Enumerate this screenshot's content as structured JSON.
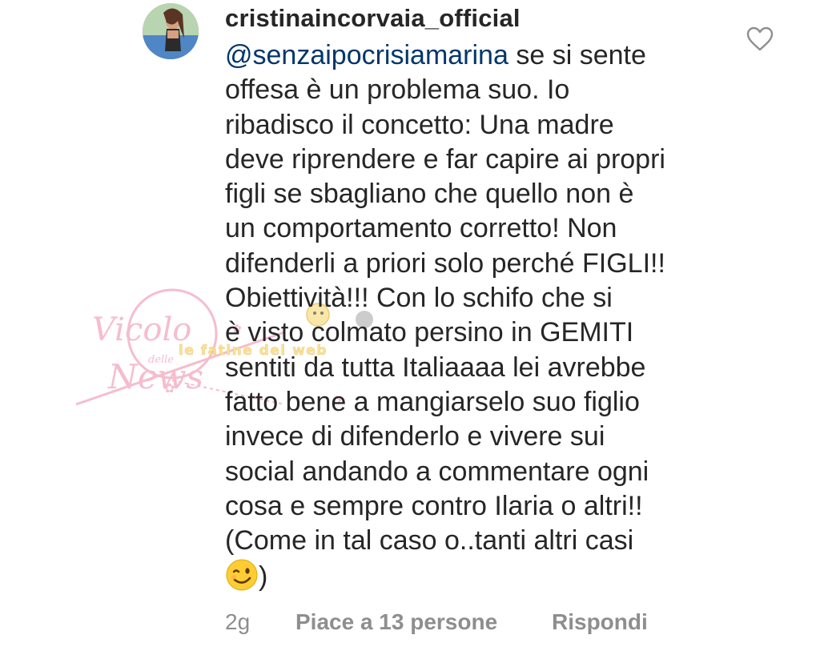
{
  "comment": {
    "username": "cristinaincorvaia_official",
    "mention": "@senzaipocrisiamarina",
    "lines": [
      " se si sente",
      "offesa è un problema suo. Io",
      "ribadisco il concetto: Una madre",
      "deve riprendere e far capire ai propri",
      "figli se sbagliano che quello non è",
      "un comportamento corretto! Non",
      "difenderli a priori solo perché FIGLI!!",
      "Obiettività!!! Con lo schifo che si",
      "è visto colmato persino in GEMITI",
      "sentiti da tutta Italiaaaa lei avrebbe",
      "fatto bene a mangiarselo suo figlio",
      "invece di difenderlo e vivere sui",
      "social andando a commentare ogni",
      "cosa e sempre contro Ilaria o altri!!",
      "(Come in tal caso o..tanti altri casi"
    ],
    "last_line_suffix": ")",
    "emoji": "winking-face",
    "time": "2g",
    "likes": "Piace a 13 persone",
    "reply": "Rispondi"
  },
  "watermark": {
    "brand_line1": "Vicolo",
    "brand_small": "delle",
    "brand_line2": "News",
    "tagline": "le fatine del web"
  },
  "colors": {
    "text": "#262626",
    "mention": "#00376b",
    "muted": "#8e8e8e",
    "watermark_pink": "#f2a7bd"
  }
}
